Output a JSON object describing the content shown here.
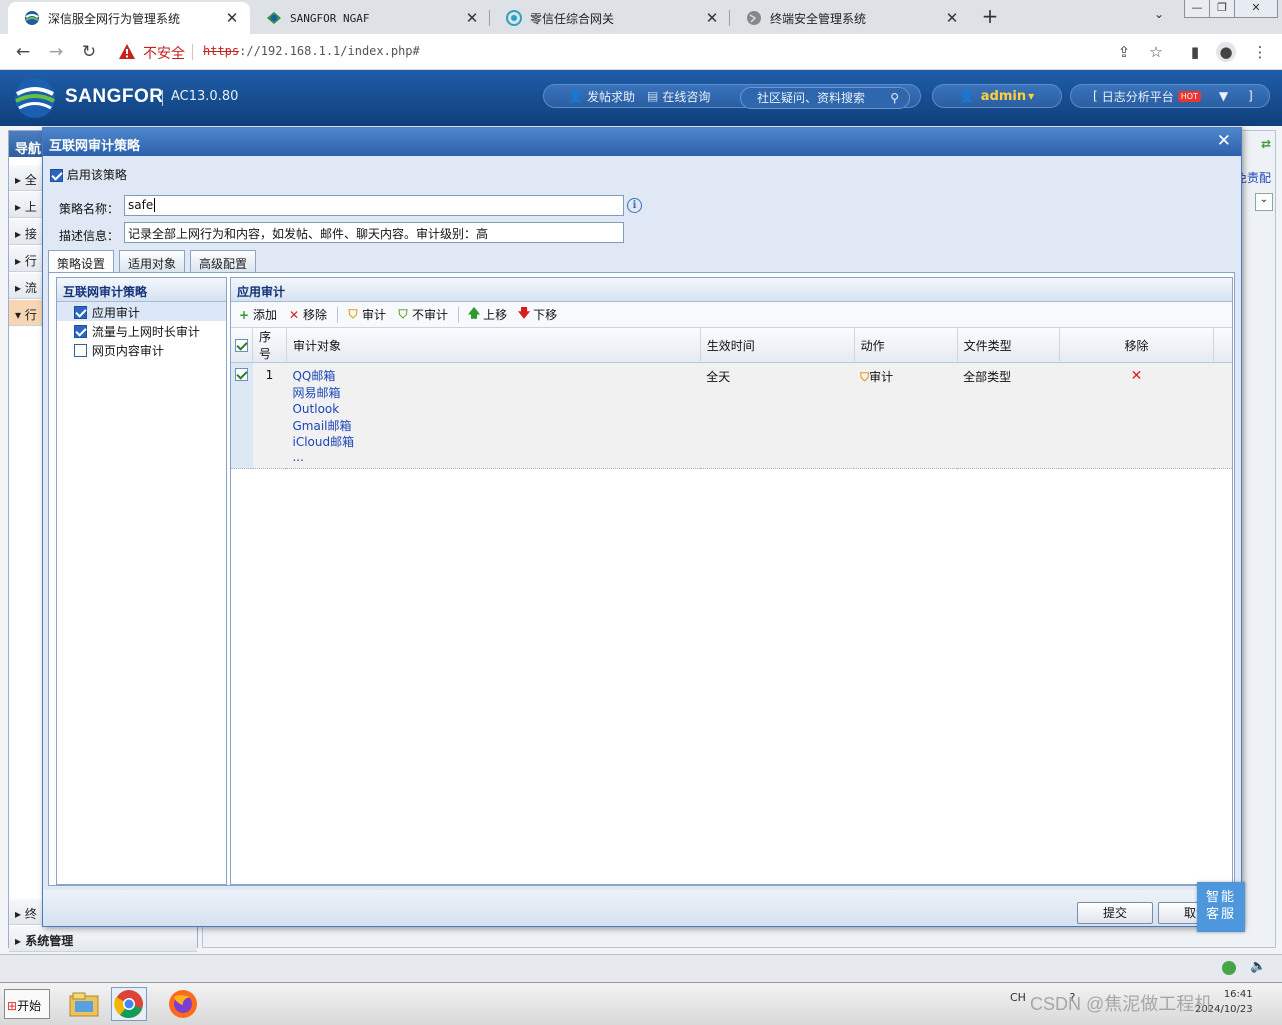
{
  "browser": {
    "tabs": [
      {
        "title": "深信服全网行为管理系统",
        "active": true
      },
      {
        "title": "SANGFOR NGAF",
        "active": false
      },
      {
        "title": "零信任综合网关",
        "active": false
      },
      {
        "title": "终端安全管理系统",
        "active": false
      }
    ],
    "security_label": "不安全",
    "url_scheme": "https",
    "url_rest": "://192.168.1.1/index.php#"
  },
  "header": {
    "brand": "SANGFOR",
    "version": "AC13.0.80",
    "forum": "发帖求助",
    "consult": "在线咨询",
    "search_placeholder": "社区疑问、资料搜索",
    "user": "admin",
    "log_platform": "日志分析平台",
    "hot_badge": "HOT",
    "bracket_open": "[",
    "bracket_close": "]"
  },
  "background": {
    "nav_title": "导航",
    "nav_items": [
      "全",
      "上",
      "接",
      "行",
      "流",
      "行",
      "终",
      "系统管理"
    ],
    "nav_sub": [
      "?",
      "?",
      "?",
      "?"
    ],
    "right_label": "免责配"
  },
  "dialog": {
    "title": "互联网审计策略",
    "enable_label": "启用该策略",
    "name_label": "策略名称：",
    "name_value": "safe",
    "desc_label": "描述信息：",
    "desc_value": "记录全部上网行为和内容，如发帖、邮件、聊天内容。审计级别：高",
    "tabs": [
      "策略设置",
      "适用对象",
      "高级配置"
    ],
    "tree": {
      "title": "互联网审计策略",
      "items": [
        {
          "label": "应用审计",
          "checked": true
        },
        {
          "label": "流量与上网时长审计",
          "checked": true
        },
        {
          "label": "网页内容审计",
          "checked": false
        }
      ]
    },
    "panel": {
      "title": "应用审计",
      "toolbar": [
        "添加",
        "移除",
        "审计",
        "不审计",
        "上移",
        "下移"
      ],
      "columns": [
        "序号",
        "审计对象",
        "生效时间",
        "动作",
        "文件类型",
        "移除"
      ],
      "rows": [
        {
          "seq": "1",
          "objects": [
            "QQ邮箱",
            "网易邮箱",
            "Outlook",
            "Gmail邮箱",
            "iCloud邮箱",
            "..."
          ],
          "time": "全天",
          "action": "审计",
          "filetype": "全部类型"
        }
      ]
    },
    "submit": "提交",
    "cancel": "取消"
  },
  "assistant": {
    "line1": "智能",
    "line2": "客服"
  },
  "taskbar": {
    "start": "开始",
    "ime": "CH",
    "time": "16:41",
    "date": "2024/10/23"
  },
  "watermark": "CSDN @焦泥做工程机"
}
